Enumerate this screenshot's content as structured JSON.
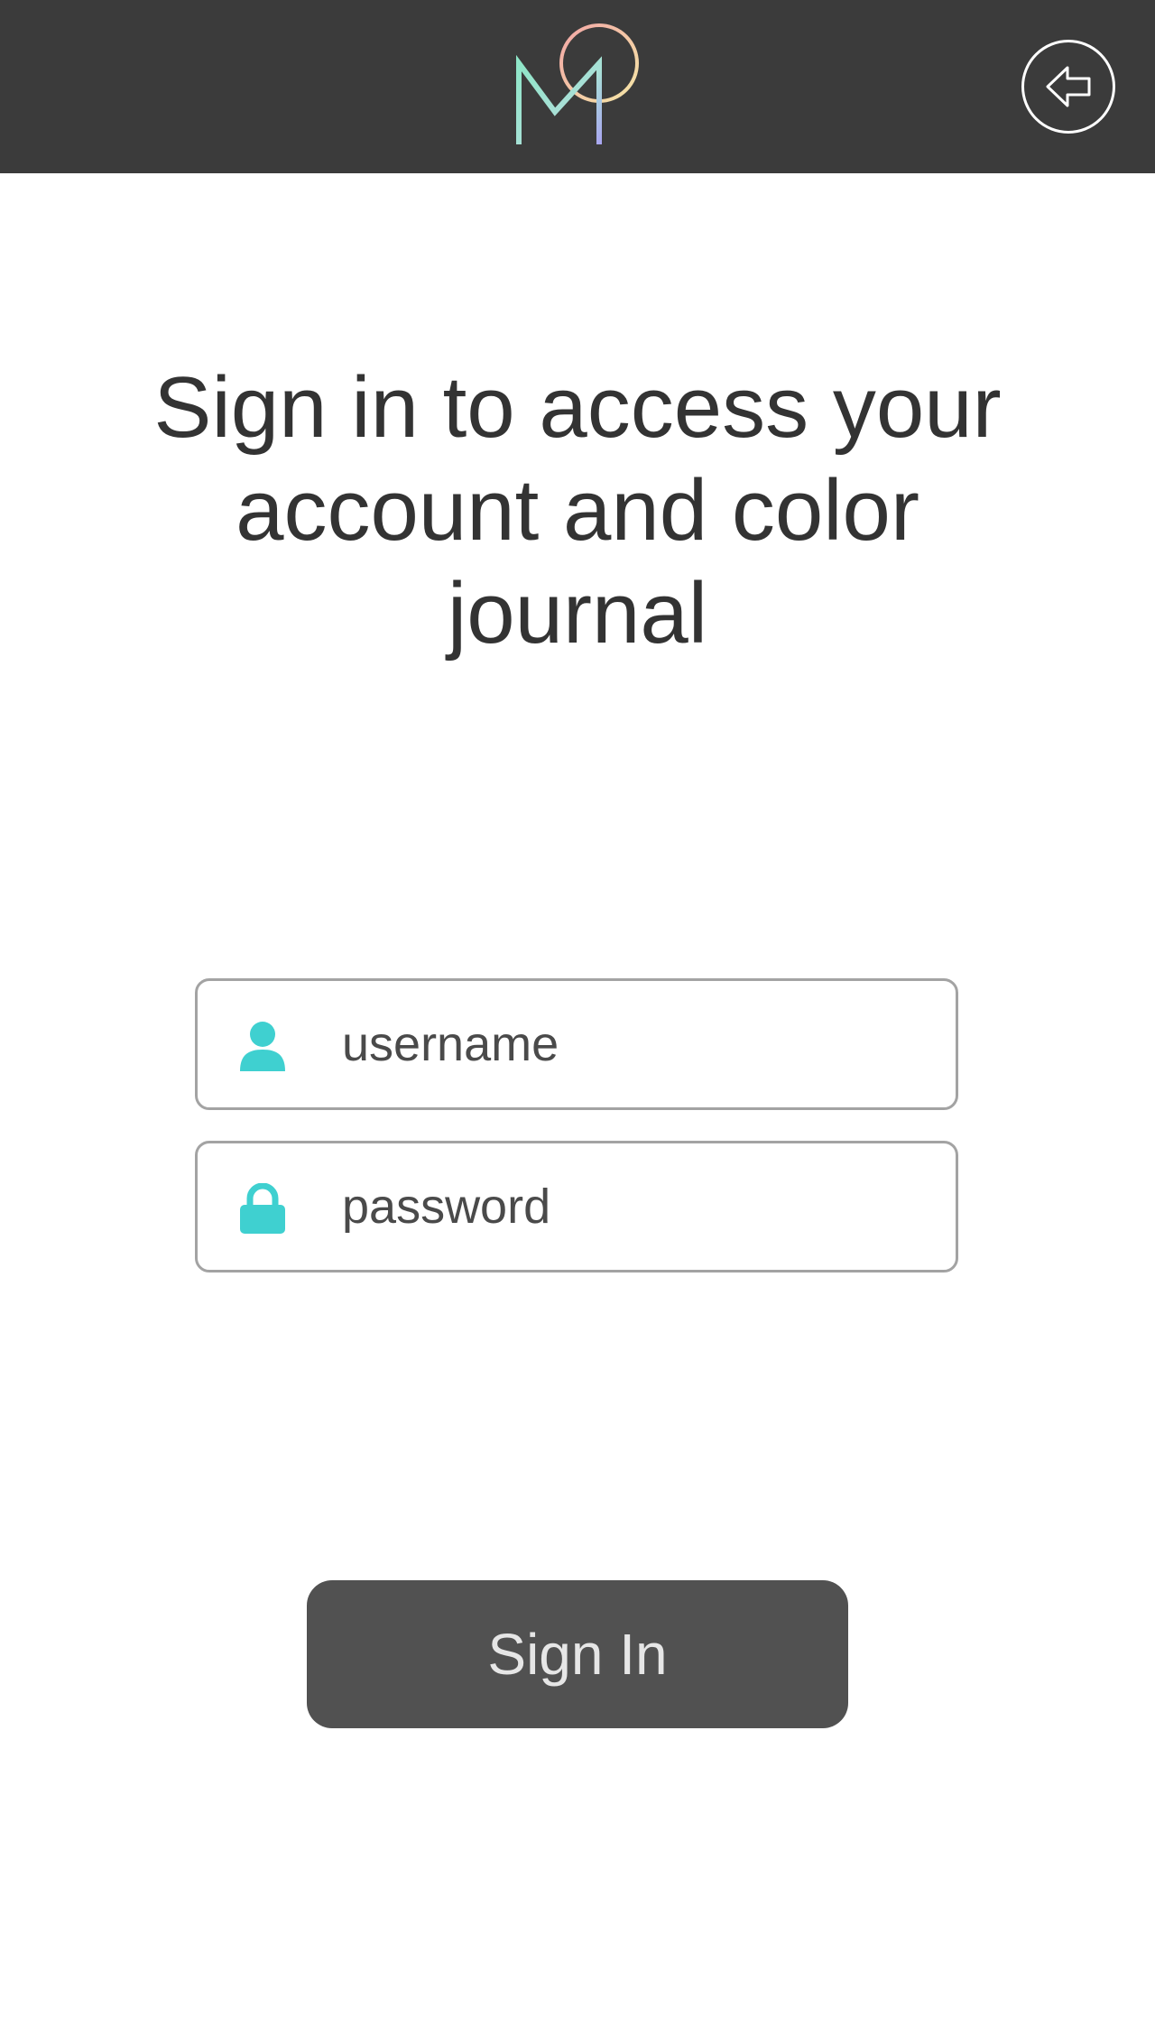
{
  "header": {
    "logo_icon": "monogram-logo-icon",
    "back_icon": "back-arrow-icon"
  },
  "main": {
    "title": "Sign in to access your account and color journal"
  },
  "form": {
    "username": {
      "icon": "user-icon",
      "value": "",
      "placeholder": "username"
    },
    "password": {
      "icon": "lock-icon",
      "value": "",
      "placeholder": "password"
    },
    "submit_label": "Sign In"
  },
  "colors": {
    "header_bg": "#3b3b3b",
    "accent_teal": "#3fd0d0",
    "button_bg": "#515151",
    "field_border": "#a3a3a3"
  }
}
